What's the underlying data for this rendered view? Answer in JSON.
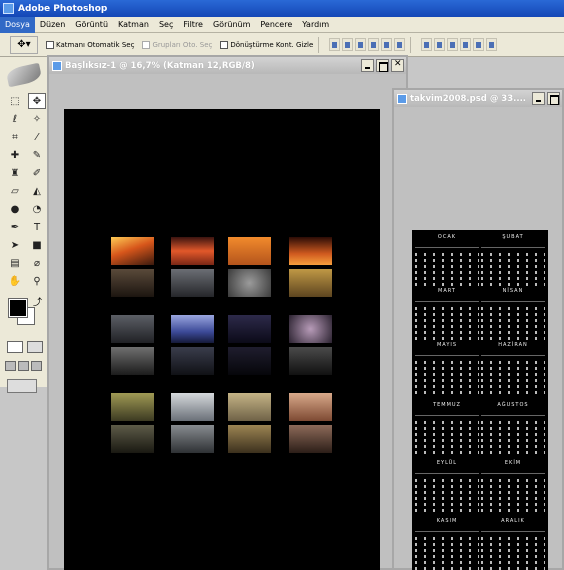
{
  "app": {
    "title": "Adobe Photoshop"
  },
  "menu": [
    "Dosya",
    "Düzen",
    "Görüntü",
    "Katman",
    "Seç",
    "Filtre",
    "Görünüm",
    "Pencere",
    "Yardım"
  ],
  "options": {
    "auto_select_layer": "Katmanı Otomatik Seç",
    "auto_select_groups": "Grupları Oto. Seç",
    "show_transform": "Dönüştürme Kont. Gizle"
  },
  "doc1": {
    "title": "Başlıksız-1 @ 16,7% (Katman 12,RGB/8)"
  },
  "doc2": {
    "title": "takvim2008.psd @ 33...."
  },
  "colors": {
    "foreground": "#000000",
    "background": "#ffffff"
  },
  "tools": [
    "marquee-icon",
    "move-icon",
    "lasso-icon",
    "magic-wand-icon",
    "crop-icon",
    "slice-icon",
    "healing-icon",
    "brush-icon",
    "stamp-icon",
    "history-brush-icon",
    "eraser-icon",
    "bucket-icon",
    "blur-icon",
    "dodge-icon",
    "pen-icon",
    "type-icon",
    "path-select-icon",
    "shape-icon",
    "notes-icon",
    "eyedropper-icon",
    "hand-icon",
    "zoom-icon"
  ],
  "calendar_months": [
    "OCAK",
    "ŞUBAT",
    "MART",
    "NİSAN",
    "MAYIS",
    "HAZİRAN",
    "TEMMUZ",
    "AĞUSTOS",
    "EYLÜL",
    "EKİM",
    "KASIM",
    "ARALIK"
  ]
}
